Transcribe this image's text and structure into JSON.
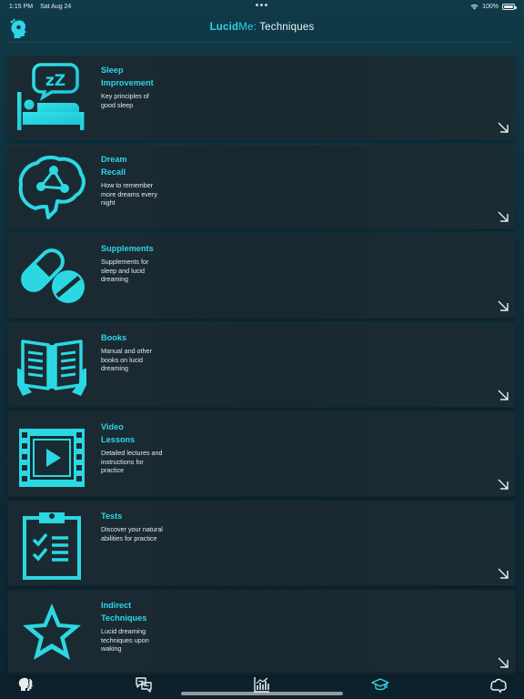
{
  "status_bar": {
    "time": "1:15 PM",
    "date": "Sat Aug 24",
    "battery": "100%"
  },
  "header": {
    "brand_lucid": "Lucid",
    "brand_me": "Me:",
    "section": "Techniques"
  },
  "techniques": [
    {
      "title": "Sleep\nImprovement",
      "description": "Key principles of\ngood sleep",
      "icon": "sleep-bed-icon"
    },
    {
      "title": "Dream\nRecall",
      "description": "How to remember\nmore dreams every\nnight",
      "icon": "brain-network-icon"
    },
    {
      "title": "Supplements",
      "description": "Supplements for\nsleep and lucid\ndreaming",
      "icon": "pills-icon"
    },
    {
      "title": "Books",
      "description": "Manual and other\nbooks on lucid\ndreaming",
      "icon": "open-book-icon"
    },
    {
      "title": "Video\nLessons",
      "description": "Detailed lectures and\ninstructions for\npractice",
      "icon": "video-film-icon"
    },
    {
      "title": "Tests",
      "description": "Discover your natural\nabilities for practice",
      "icon": "clipboard-checklist-icon"
    },
    {
      "title": "Indirect\nTechniques",
      "description": "Lucid dreaming\ntechniques upon\nwaking",
      "icon": "star-icon"
    }
  ],
  "tabbar": {
    "tabs": [
      {
        "icon": "heads-icon",
        "active": false
      },
      {
        "icon": "chat-bubbles-icon",
        "active": false
      },
      {
        "icon": "chart-icon",
        "active": false
      },
      {
        "icon": "graduation-cap-icon",
        "active": true
      },
      {
        "icon": "cloud-icon",
        "active": false
      }
    ]
  },
  "colors": {
    "accent": "#2fd6e6",
    "card_bg": "#1a2a33",
    "background": "#0f2f3b",
    "tab_inactive": "#e6eef0"
  }
}
